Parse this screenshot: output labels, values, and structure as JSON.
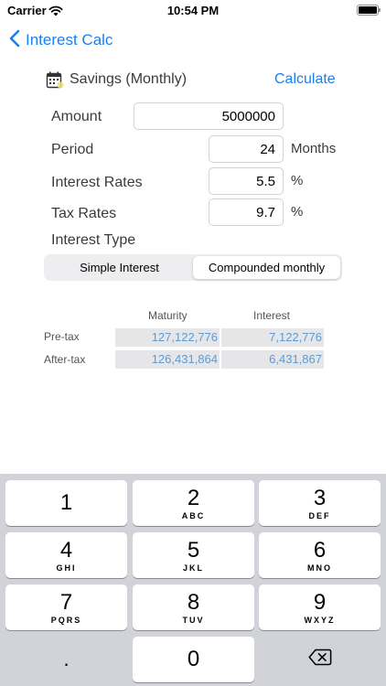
{
  "status_bar": {
    "carrier": "Carrier",
    "time": "10:54 PM",
    "wifi_icon": "wifi-icon",
    "battery_icon": "battery-icon"
  },
  "nav": {
    "back_label": "Interest Calc"
  },
  "form": {
    "icon": "calculator-icon",
    "title": "Savings (Monthly)",
    "calculate_label": "Calculate",
    "amount": {
      "label": "Amount",
      "value": "5000000"
    },
    "period": {
      "label": "Period",
      "value": "24",
      "unit": "Months"
    },
    "interest_rate": {
      "label": "Interest Rates",
      "value": "5.5",
      "unit": "%"
    },
    "tax_rate": {
      "label": "Tax Rates",
      "value": "9.7",
      "unit": "%"
    },
    "interest_type": {
      "label": "Interest Type",
      "options": [
        "Simple Interest",
        "Compounded monthly"
      ],
      "selected": "Compounded monthly"
    }
  },
  "results": {
    "columns": [
      "Maturity",
      "Interest"
    ],
    "rows": [
      {
        "label": "Pre-tax",
        "maturity": "127,122,776",
        "interest": "7,122,776"
      },
      {
        "label": "After-tax",
        "maturity": "126,431,864",
        "interest": "6,431,867"
      }
    ]
  },
  "keyboard": {
    "keys": [
      {
        "digit": "1",
        "letters": ""
      },
      {
        "digit": "2",
        "letters": "ABC"
      },
      {
        "digit": "3",
        "letters": "DEF"
      },
      {
        "digit": "4",
        "letters": "GHI"
      },
      {
        "digit": "5",
        "letters": "JKL"
      },
      {
        "digit": "6",
        "letters": "MNO"
      },
      {
        "digit": "7",
        "letters": "PQRS"
      },
      {
        "digit": "8",
        "letters": "TUV"
      },
      {
        "digit": "9",
        "letters": "WXYZ"
      },
      {
        "digit": ".",
        "letters": ""
      },
      {
        "digit": "0",
        "letters": ""
      }
    ],
    "delete_icon": "backspace-icon"
  },
  "colors": {
    "accent": "#1a7ff0",
    "result_text": "#5b9bd5",
    "result_cell": "#e6e6e8",
    "keyboard_bg": "#d1d3d9"
  }
}
